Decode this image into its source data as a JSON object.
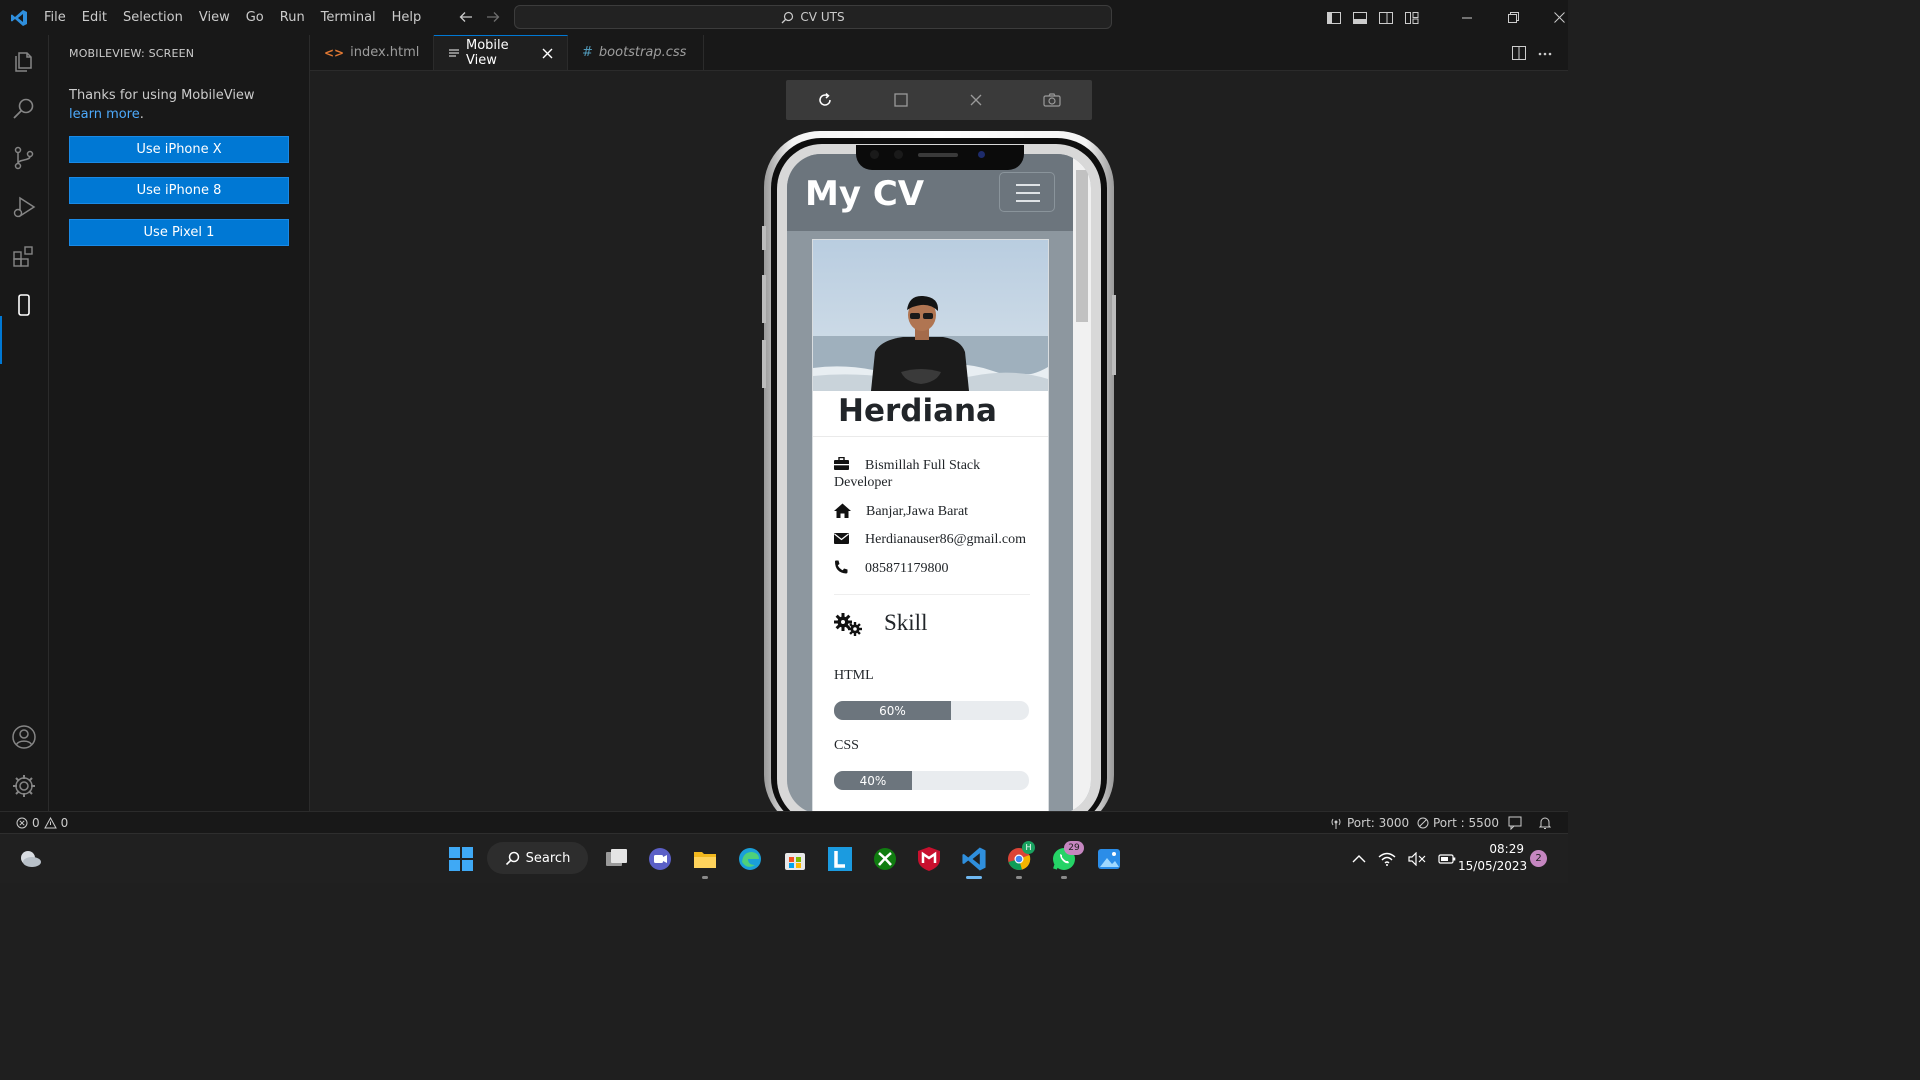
{
  "titlebar": {
    "menu": [
      "File",
      "Edit",
      "Selection",
      "View",
      "Go",
      "Run",
      "Terminal",
      "Help"
    ],
    "command_center": "CV UTS"
  },
  "sidebar": {
    "title": "MOBILEVIEW: SCREEN",
    "message": "Thanks for using MobileView ",
    "link": "learn more",
    "message_end": ".",
    "buttons": [
      "Use iPhone X",
      "Use iPhone 8",
      "Use Pixel 1"
    ]
  },
  "tabs": [
    {
      "label": "index.html",
      "icon": "html-file-icon"
    },
    {
      "label": "Mobile View",
      "icon": "preview-icon",
      "active": true
    },
    {
      "label": "bootstrap.css",
      "icon": "css-hash-icon"
    }
  ],
  "preview": {
    "brand": "My CV",
    "name": "Herdiana",
    "info": [
      {
        "icon": "briefcase-icon",
        "text": "Bismillah Full Stack Developer"
      },
      {
        "icon": "home-icon",
        "text": "Banjar,Jawa Barat"
      },
      {
        "icon": "envelope-icon",
        "text": "Herdianauser86@gmail.com"
      },
      {
        "icon": "phone-icon",
        "text": "085871179800"
      }
    ],
    "skill_title": "Skill",
    "skills": [
      {
        "label": "HTML",
        "percent": 60,
        "text": "60%"
      },
      {
        "label": "CSS",
        "percent": 40,
        "text": "40%"
      }
    ]
  },
  "statusbar": {
    "errors": "0",
    "warnings": "0",
    "port1": "Port: 3000",
    "port2": "Port : 5500"
  },
  "taskbar": {
    "search": "Search",
    "chrome_badge": "H",
    "whatsapp_badge": "29",
    "time": "08:29",
    "date": "15/05/2023",
    "notifications": "2"
  },
  "colors": {
    "accent": "#0078d4",
    "navbar": "#6c757d",
    "progress_fill": "#6c757d"
  }
}
